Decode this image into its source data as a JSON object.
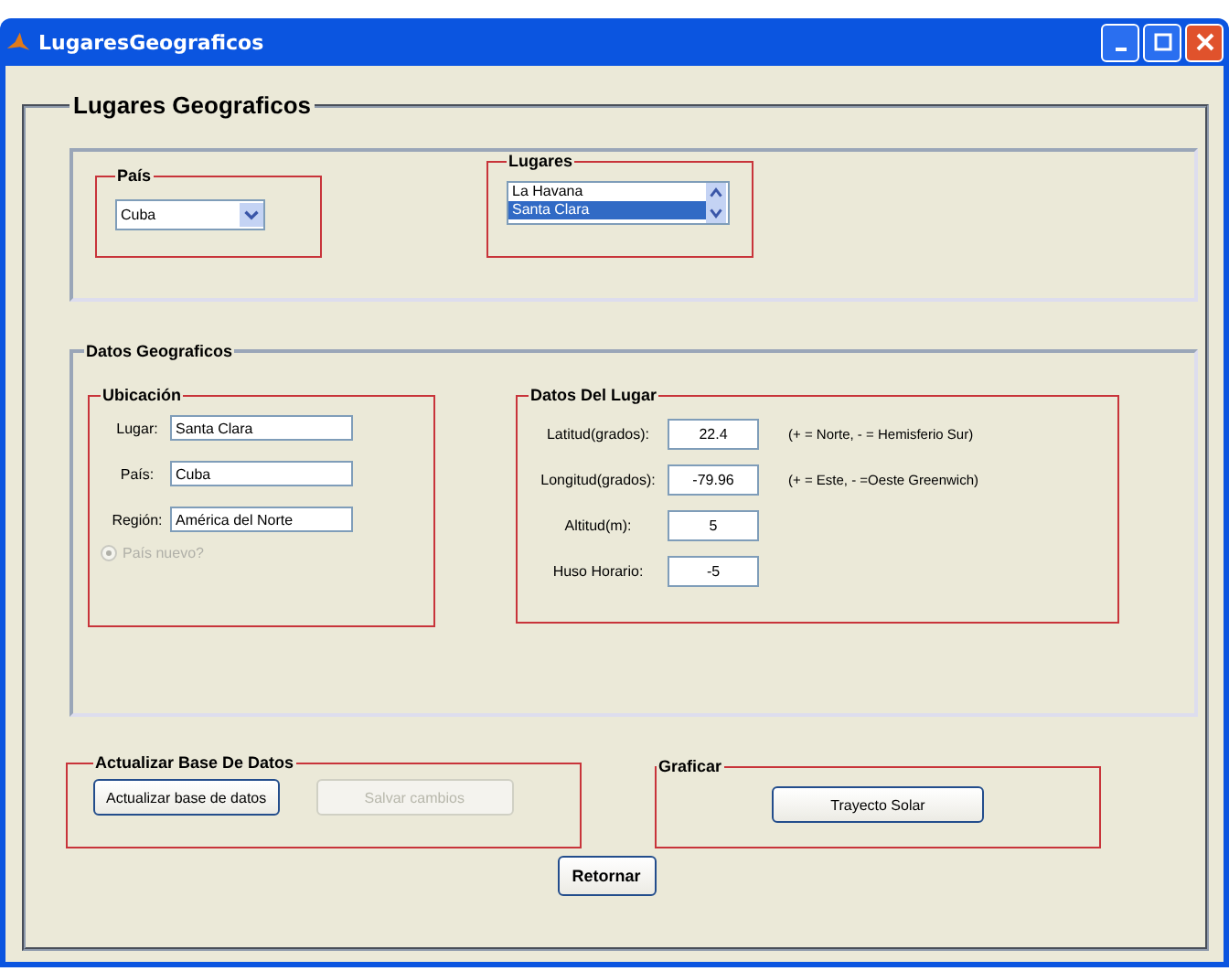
{
  "window": {
    "title": "LugaresGeograficos"
  },
  "main_panel": {
    "title": "Lugares Geograficos"
  },
  "pais_group": {
    "title": "País",
    "dropdown": {
      "value": "Cuba"
    }
  },
  "lugares_group": {
    "title": "Lugares",
    "items": [
      {
        "label": "La Havana",
        "selected": false
      },
      {
        "label": "Santa Clara",
        "selected": true
      }
    ]
  },
  "datos_panel": {
    "title": "Datos Geograficos"
  },
  "ubicacion": {
    "title": "Ubicación",
    "fields": [
      {
        "label": "Lugar:",
        "value": "Santa Clara"
      },
      {
        "label": "País:",
        "value": "Cuba"
      },
      {
        "label": "Región:",
        "value": "América del Norte"
      }
    ],
    "radio": {
      "label": "País nuevo?",
      "checked": true,
      "disabled": true
    }
  },
  "datos_lugar": {
    "title": "Datos Del Lugar",
    "fields": [
      {
        "label": "Latitud(grados):",
        "value": "22.4",
        "hint": "(+ = Norte, - = Hemisferio Sur)"
      },
      {
        "label": "Longitud(grados):",
        "value": "-79.96",
        "hint": "(+ = Este, - =Oeste Greenwich)"
      },
      {
        "label": "Altitud(m):",
        "value": "5"
      },
      {
        "label": "Huso Horario:",
        "value": "-5"
      }
    ]
  },
  "actualizar_group": {
    "title": "Actualizar Base De Datos",
    "buttons": [
      {
        "label": "Actualizar base de datos",
        "disabled": false
      },
      {
        "label": "Salvar cambios",
        "disabled": true
      }
    ]
  },
  "graficar_group": {
    "title": "Graficar",
    "button": "Trayecto Solar"
  },
  "return_button": "Retornar"
}
